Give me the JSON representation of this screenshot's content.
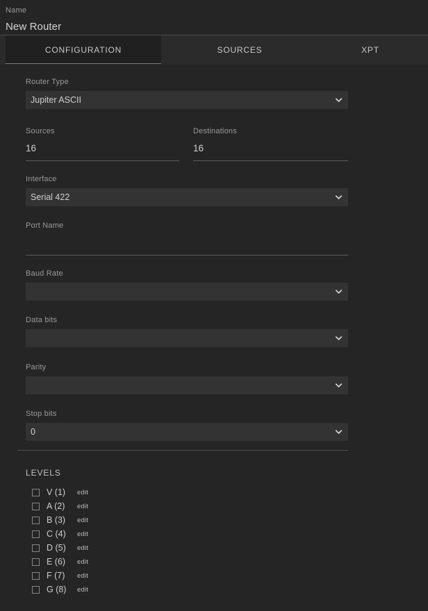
{
  "header": {
    "name_label": "Name",
    "name_value": "New Router"
  },
  "tabs": [
    {
      "label": "CONFIGURATION",
      "active": true
    },
    {
      "label": "SOURCES",
      "active": false
    },
    {
      "label": "XPT",
      "active": false
    }
  ],
  "colors": {
    "accent": "#2196c4",
    "page_bg": "#252525",
    "tabbar_bg": "#2b2b2b",
    "active_tab_bg": "#202020",
    "control_bg": "#333333",
    "label_text": "#9a9a9a",
    "value_text": "#d0d0d0",
    "underline": "#5a5a5a"
  },
  "form": {
    "router_type": {
      "label": "Router Type",
      "value": "Jupiter ASCII",
      "type": "select",
      "icon": "chevron-down-icon"
    },
    "sources": {
      "label": "Sources",
      "value": "16",
      "type": "text",
      "placeholder": ""
    },
    "destinations": {
      "label": "Destinations",
      "value": "16",
      "type": "text",
      "placeholder": ""
    },
    "interface": {
      "label": "Interface",
      "value": "Serial 422",
      "type": "select",
      "icon": "chevron-down-icon"
    },
    "port_name": {
      "label": "Port Name",
      "value": "",
      "type": "text",
      "placeholder": ""
    },
    "baud_rate": {
      "label": "Baud Rate",
      "value": "",
      "type": "select",
      "icon": "chevron-down-icon"
    },
    "data_bits": {
      "label": "Data bits",
      "value": "",
      "type": "select",
      "icon": "chevron-down-icon"
    },
    "parity": {
      "label": "Parity",
      "value": "",
      "type": "select",
      "icon": "chevron-down-icon"
    },
    "stop_bits": {
      "label": "Stop bits",
      "value": "0",
      "type": "select",
      "icon": "chevron-down-icon"
    }
  },
  "levels": {
    "title": "LEVELS",
    "edit_label": "edit",
    "items": [
      {
        "name": "V (1)",
        "checked": false,
        "edit": "edit"
      },
      {
        "name": "A (2)",
        "checked": false,
        "edit": "edit"
      },
      {
        "name": "B (3)",
        "checked": false,
        "edit": "edit"
      },
      {
        "name": "C (4)",
        "checked": false,
        "edit": "edit"
      },
      {
        "name": "D (5)",
        "checked": false,
        "edit": "edit"
      },
      {
        "name": "E (6)",
        "checked": false,
        "edit": "edit"
      },
      {
        "name": "F (7)",
        "checked": false,
        "edit": "edit"
      },
      {
        "name": "G (8)",
        "checked": false,
        "edit": "edit"
      }
    ]
  }
}
